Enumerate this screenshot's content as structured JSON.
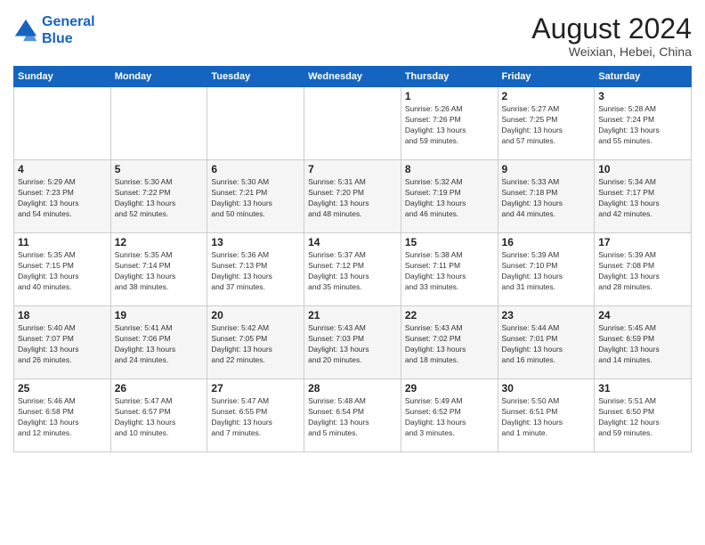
{
  "logo": {
    "line1": "General",
    "line2": "Blue"
  },
  "header": {
    "month_year": "August 2024",
    "location": "Weixian, Hebei, China"
  },
  "weekdays": [
    "Sunday",
    "Monday",
    "Tuesday",
    "Wednesday",
    "Thursday",
    "Friday",
    "Saturday"
  ],
  "weeks": [
    [
      {
        "day": "",
        "info": ""
      },
      {
        "day": "",
        "info": ""
      },
      {
        "day": "",
        "info": ""
      },
      {
        "day": "",
        "info": ""
      },
      {
        "day": "1",
        "info": "Sunrise: 5:26 AM\nSunset: 7:26 PM\nDaylight: 13 hours\nand 59 minutes."
      },
      {
        "day": "2",
        "info": "Sunrise: 5:27 AM\nSunset: 7:25 PM\nDaylight: 13 hours\nand 57 minutes."
      },
      {
        "day": "3",
        "info": "Sunrise: 5:28 AM\nSunset: 7:24 PM\nDaylight: 13 hours\nand 55 minutes."
      }
    ],
    [
      {
        "day": "4",
        "info": "Sunrise: 5:29 AM\nSunset: 7:23 PM\nDaylight: 13 hours\nand 54 minutes."
      },
      {
        "day": "5",
        "info": "Sunrise: 5:30 AM\nSunset: 7:22 PM\nDaylight: 13 hours\nand 52 minutes."
      },
      {
        "day": "6",
        "info": "Sunrise: 5:30 AM\nSunset: 7:21 PM\nDaylight: 13 hours\nand 50 minutes."
      },
      {
        "day": "7",
        "info": "Sunrise: 5:31 AM\nSunset: 7:20 PM\nDaylight: 13 hours\nand 48 minutes."
      },
      {
        "day": "8",
        "info": "Sunrise: 5:32 AM\nSunset: 7:19 PM\nDaylight: 13 hours\nand 46 minutes."
      },
      {
        "day": "9",
        "info": "Sunrise: 5:33 AM\nSunset: 7:18 PM\nDaylight: 13 hours\nand 44 minutes."
      },
      {
        "day": "10",
        "info": "Sunrise: 5:34 AM\nSunset: 7:17 PM\nDaylight: 13 hours\nand 42 minutes."
      }
    ],
    [
      {
        "day": "11",
        "info": "Sunrise: 5:35 AM\nSunset: 7:15 PM\nDaylight: 13 hours\nand 40 minutes."
      },
      {
        "day": "12",
        "info": "Sunrise: 5:35 AM\nSunset: 7:14 PM\nDaylight: 13 hours\nand 38 minutes."
      },
      {
        "day": "13",
        "info": "Sunrise: 5:36 AM\nSunset: 7:13 PM\nDaylight: 13 hours\nand 37 minutes."
      },
      {
        "day": "14",
        "info": "Sunrise: 5:37 AM\nSunset: 7:12 PM\nDaylight: 13 hours\nand 35 minutes."
      },
      {
        "day": "15",
        "info": "Sunrise: 5:38 AM\nSunset: 7:11 PM\nDaylight: 13 hours\nand 33 minutes."
      },
      {
        "day": "16",
        "info": "Sunrise: 5:39 AM\nSunset: 7:10 PM\nDaylight: 13 hours\nand 31 minutes."
      },
      {
        "day": "17",
        "info": "Sunrise: 5:39 AM\nSunset: 7:08 PM\nDaylight: 13 hours\nand 28 minutes."
      }
    ],
    [
      {
        "day": "18",
        "info": "Sunrise: 5:40 AM\nSunset: 7:07 PM\nDaylight: 13 hours\nand 26 minutes."
      },
      {
        "day": "19",
        "info": "Sunrise: 5:41 AM\nSunset: 7:06 PM\nDaylight: 13 hours\nand 24 minutes."
      },
      {
        "day": "20",
        "info": "Sunrise: 5:42 AM\nSunset: 7:05 PM\nDaylight: 13 hours\nand 22 minutes."
      },
      {
        "day": "21",
        "info": "Sunrise: 5:43 AM\nSunset: 7:03 PM\nDaylight: 13 hours\nand 20 minutes."
      },
      {
        "day": "22",
        "info": "Sunrise: 5:43 AM\nSunset: 7:02 PM\nDaylight: 13 hours\nand 18 minutes."
      },
      {
        "day": "23",
        "info": "Sunrise: 5:44 AM\nSunset: 7:01 PM\nDaylight: 13 hours\nand 16 minutes."
      },
      {
        "day": "24",
        "info": "Sunrise: 5:45 AM\nSunset: 6:59 PM\nDaylight: 13 hours\nand 14 minutes."
      }
    ],
    [
      {
        "day": "25",
        "info": "Sunrise: 5:46 AM\nSunset: 6:58 PM\nDaylight: 13 hours\nand 12 minutes."
      },
      {
        "day": "26",
        "info": "Sunrise: 5:47 AM\nSunset: 6:57 PM\nDaylight: 13 hours\nand 10 minutes."
      },
      {
        "day": "27",
        "info": "Sunrise: 5:47 AM\nSunset: 6:55 PM\nDaylight: 13 hours\nand 7 minutes."
      },
      {
        "day": "28",
        "info": "Sunrise: 5:48 AM\nSunset: 6:54 PM\nDaylight: 13 hours\nand 5 minutes."
      },
      {
        "day": "29",
        "info": "Sunrise: 5:49 AM\nSunset: 6:52 PM\nDaylight: 13 hours\nand 3 minutes."
      },
      {
        "day": "30",
        "info": "Sunrise: 5:50 AM\nSunset: 6:51 PM\nDaylight: 13 hours\nand 1 minute."
      },
      {
        "day": "31",
        "info": "Sunrise: 5:51 AM\nSunset: 6:50 PM\nDaylight: 12 hours\nand 59 minutes."
      }
    ]
  ]
}
